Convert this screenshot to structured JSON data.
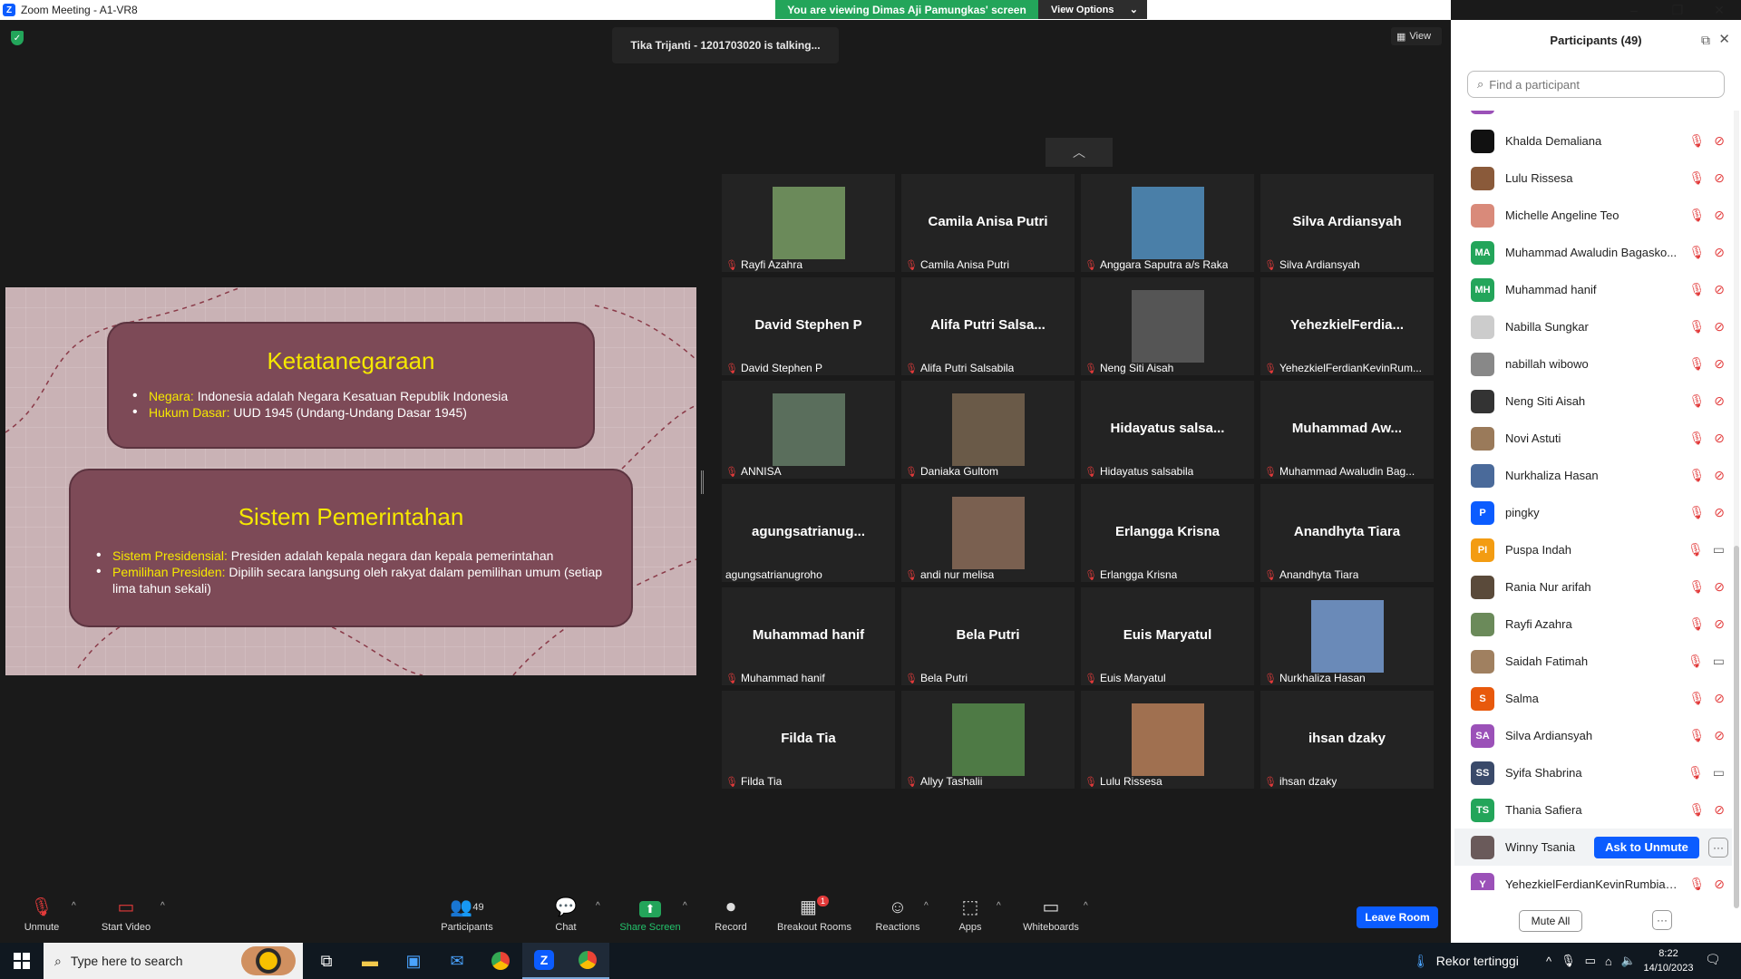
{
  "window": {
    "title": "Zoom Meeting - A1-VR8",
    "viewing_banner": "You are viewing Dimas Aji Pamungkas' screen",
    "view_options": "View Options"
  },
  "meeting": {
    "talking": "Tika Trijanti  - 1201703020 is talking...",
    "view_label": "View"
  },
  "slide": {
    "card1_title": "Ketatanegaraan",
    "card1_items": [
      {
        "key": "Negara:",
        "text": " Indonesia adalah Negara Kesatuan Republik Indonesia"
      },
      {
        "key": "Hukum Dasar:",
        "text": " UUD 1945 (Undang-Undang Dasar 1945)"
      }
    ],
    "card2_title": "Sistem Pemerintahan",
    "card2_items": [
      {
        "key": "Sistem Presidensial:",
        "text": " Presiden adalah kepala negara dan kepala pemerintahan"
      },
      {
        "key": "Pemilihan Presiden:",
        "text": " Dipilih secara langsung oleh rakyat dalam pemilihan umum (setiap lima tahun sekali)"
      }
    ]
  },
  "gallery": [
    {
      "name": "",
      "label": "Rayfi Azahra",
      "photo": "#6b8a5a",
      "muted": true
    },
    {
      "name": "Camila Anisa Putri",
      "label": "Camila Anisa Putri",
      "photo": "",
      "muted": true
    },
    {
      "name": "",
      "label": "Anggara Saputra a/s Raka",
      "photo": "#4a7fa8",
      "muted": true
    },
    {
      "name": "Silva Ardiansyah",
      "label": "Silva Ardiansyah",
      "photo": "",
      "muted": true
    },
    {
      "name": "David Stephen P",
      "label": "David Stephen P",
      "photo": "",
      "muted": true
    },
    {
      "name": "Alifa  Putri  Salsa...",
      "label": "Alifa Putri Salsabila",
      "photo": "",
      "muted": true
    },
    {
      "name": "",
      "label": "Neng Siti Aisah",
      "photo": "#555555",
      "muted": true
    },
    {
      "name": "YehezkielFerdia...",
      "label": "YehezkielFerdianKevinRum...",
      "photo": "",
      "muted": true
    },
    {
      "name": "",
      "label": "ANNISA",
      "photo": "#5a6e5c",
      "muted": true
    },
    {
      "name": "",
      "label": "Daniaka Gultom",
      "photo": "#6a5a48",
      "muted": true
    },
    {
      "name": "Hidayatus  salsa...",
      "label": "Hidayatus salsabila",
      "photo": "",
      "muted": true
    },
    {
      "name": "Muhammad  Aw...",
      "label": "Muhammad Awaludin Bag...",
      "photo": "",
      "muted": true
    },
    {
      "name": "agungsatrianug...",
      "label": "agungsatrianugroho",
      "photo": "",
      "muted": false
    },
    {
      "name": "",
      "label": "andi nur melisa",
      "photo": "#7a6050",
      "muted": true
    },
    {
      "name": "Erlangga Krisna",
      "label": "Erlangga Krisna",
      "photo": "",
      "muted": true
    },
    {
      "name": "Anandhyta Tiara",
      "label": "Anandhyta Tiara",
      "photo": "",
      "muted": true
    },
    {
      "name": "Muhammad hanif",
      "label": "Muhammad hanif",
      "photo": "",
      "muted": true
    },
    {
      "name": "Bela Putri",
      "label": "Bela Putri",
      "photo": "",
      "muted": true
    },
    {
      "name": "Euis Maryatul",
      "label": "Euis Maryatul",
      "photo": "",
      "muted": true
    },
    {
      "name": "",
      "label": "Nurkhaliza Hasan",
      "photo": "#6a8ab8",
      "muted": true
    },
    {
      "name": "Filda Tia",
      "label": "Filda Tia",
      "photo": "",
      "muted": true
    },
    {
      "name": "",
      "label": "Allyy Tashalii",
      "photo": "#4e7a45",
      "muted": true
    },
    {
      "name": "",
      "label": "Lulu Rissesa",
      "photo": "#a07050",
      "muted": true
    },
    {
      "name": "ihsan dzaky",
      "label": "ihsan dzaky",
      "photo": "",
      "muted": true
    }
  ],
  "toolbar": {
    "unmute": "Unmute",
    "start_video": "Start Video",
    "participants": "Participants",
    "participants_count": "49",
    "chat": "Chat",
    "share_screen": "Share Screen",
    "record": "Record",
    "breakout_rooms": "Breakout Rooms",
    "breakout_badge": "1",
    "reactions": "Reactions",
    "apps": "Apps",
    "whiteboards": "Whiteboards",
    "leave_room": "Leave Room"
  },
  "panel": {
    "title": "Participants (49)",
    "search_placeholder": "Find a participant",
    "participants": [
      {
        "name": "Khalda Demaliana",
        "initials": "",
        "color": "#111111",
        "video": "off"
      },
      {
        "name": "Lulu Rissesa",
        "initials": "",
        "color": "#8a5a3a",
        "video": "off"
      },
      {
        "name": "Michelle Angeline Teo",
        "initials": "",
        "color": "#d98a7a",
        "video": "off"
      },
      {
        "name": "Muhammad Awaludin Bagasko...",
        "initials": "MA",
        "color": "#23a55a",
        "video": "off"
      },
      {
        "name": "Muhammad hanif",
        "initials": "MH",
        "color": "#23a55a",
        "video": "off"
      },
      {
        "name": "Nabilla Sungkar",
        "initials": "",
        "color": "#cccccc",
        "video": "off"
      },
      {
        "name": "nabillah wibowo",
        "initials": "",
        "color": "#888888",
        "video": "off"
      },
      {
        "name": "Neng Siti Aisah",
        "initials": "",
        "color": "#333333",
        "video": "off"
      },
      {
        "name": "Novi Astuti",
        "initials": "",
        "color": "#9a7a5a",
        "video": "off"
      },
      {
        "name": "Nurkhaliza Hasan",
        "initials": "",
        "color": "#4a6a9a",
        "video": "off"
      },
      {
        "name": "pingky",
        "initials": "P",
        "color": "#0b5cff",
        "video": "off"
      },
      {
        "name": "Puspa Indah",
        "initials": "PI",
        "color": "#f39c12",
        "video": "on"
      },
      {
        "name": "Rania Nur arifah",
        "initials": "",
        "color": "#5a4a3a",
        "video": "off"
      },
      {
        "name": "Rayfi Azahra",
        "initials": "",
        "color": "#6b8a5a",
        "video": "off"
      },
      {
        "name": "Saidah Fatimah",
        "initials": "",
        "color": "#a08060",
        "video": "on"
      },
      {
        "name": "Salma",
        "initials": "S",
        "color": "#e8590c",
        "video": "off"
      },
      {
        "name": "Silva Ardiansyah",
        "initials": "SA",
        "color": "#9b51b8",
        "video": "off"
      },
      {
        "name": "Syifa Shabrina",
        "initials": "SS",
        "color": "#3a4a6a",
        "video": "on"
      },
      {
        "name": "Thania Safiera",
        "initials": "TS",
        "color": "#23a55a",
        "video": "off"
      },
      {
        "name": "Winny Tsania",
        "initials": "",
        "color": "#6a5a5a",
        "video": "off"
      },
      {
        "name": "YehezkielFerdianKevinRumbiak-...",
        "initials": "Y",
        "color": "#9b51b8",
        "video": "off"
      }
    ],
    "ask_to_unmute": "Ask to Unmute",
    "mute_all": "Mute All"
  },
  "taskbar": {
    "search_placeholder": "Type here to search",
    "news": "Rekor tertinggi",
    "time": "8:22",
    "date": "14/10/2023"
  }
}
